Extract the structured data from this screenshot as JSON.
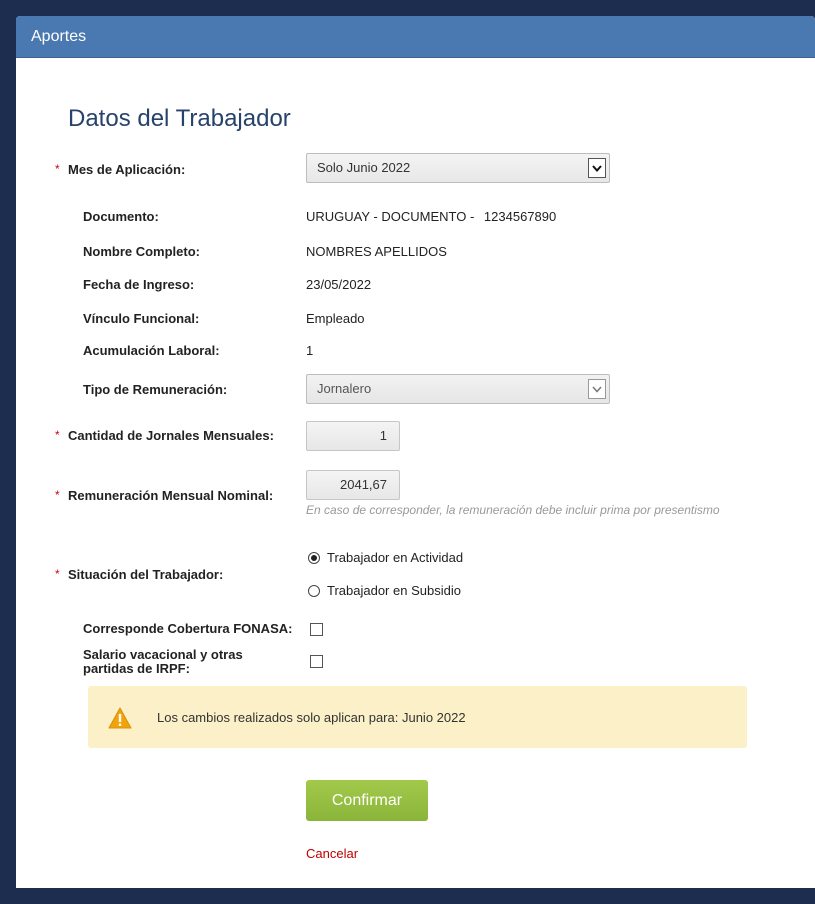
{
  "header": {
    "title": "Aportes"
  },
  "section": {
    "title": "Datos del Trabajador"
  },
  "form": {
    "required_mark": "*",
    "mes": {
      "label": "Mes de Aplicación:",
      "value": "Solo Junio 2022"
    },
    "documento": {
      "label": "Documento:",
      "value": "URUGUAY - DOCUMENTO -",
      "number": "1234567890"
    },
    "nombre": {
      "label": "Nombre Completo:",
      "value": "NOMBRES APELLIDOS"
    },
    "fecha": {
      "label": "Fecha de Ingreso:",
      "value": "23/05/2022"
    },
    "vinculo": {
      "label": "Vínculo Funcional:",
      "value": "Empleado"
    },
    "acumulacion": {
      "label": "Acumulación Laboral:",
      "value": "1"
    },
    "tipo": {
      "label": "Tipo de Remuneración:",
      "value": "Jornalero"
    },
    "jornales": {
      "label": "Cantidad de Jornales Mensuales:",
      "value": "1"
    },
    "remuneracion": {
      "label": "Remuneración Mensual Nominal:",
      "value": "2041,67",
      "hint": "En caso de corresponder, la remuneración debe incluir prima por presentismo"
    },
    "situacion": {
      "label": "Situación del Trabajador:",
      "options": [
        "Trabajador en Actividad",
        "Trabajador en Subsidio"
      ],
      "selected": "Trabajador en Actividad"
    },
    "fonasa": {
      "label": "Corresponde Cobertura FONASA:",
      "checked": false
    },
    "salario": {
      "label": "Salario vacacional y otras partidas de IRPF:",
      "checked": false
    }
  },
  "alert": {
    "text": "Los cambios realizados solo aplican para: Junio 2022",
    "icon": "warning-icon"
  },
  "actions": {
    "confirm": "Confirmar",
    "cancel": "Cancelar"
  },
  "colors": {
    "header": "#4a78b0",
    "confirm": "#97c041",
    "alert_bg": "#fbf0c7",
    "required": "#d0021b",
    "title": "#27426b"
  }
}
